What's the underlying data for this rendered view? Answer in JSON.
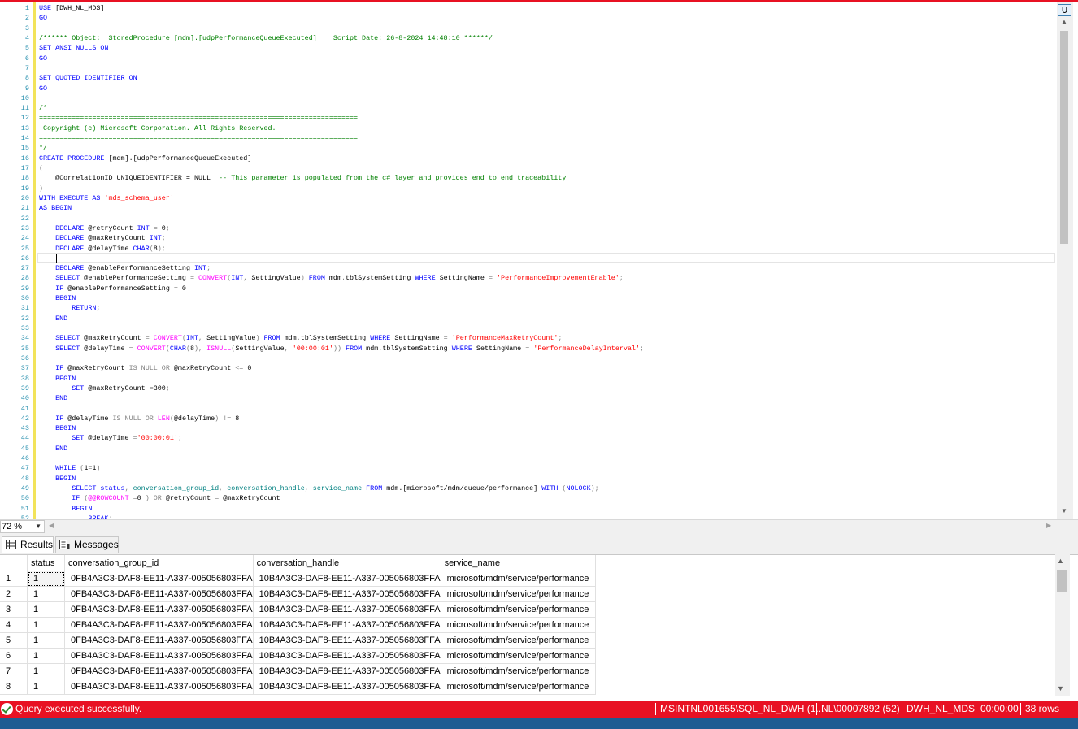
{
  "colors": {
    "status_bar": "#e81123",
    "keyword": "#0000ff",
    "comment": "#008000",
    "string": "#ff0000",
    "function": "#ff00ff",
    "line_number": "#2b91af",
    "bottom_bar": "#1e5c92"
  },
  "editor": {
    "line_numbers": [
      "1",
      "2",
      "3",
      "4",
      "5",
      "6",
      "7",
      "8",
      "9",
      "10",
      "11",
      "12",
      "13",
      "14",
      "15",
      "16",
      "17",
      "18",
      "19",
      "20",
      "21",
      "22",
      "23",
      "24",
      "25",
      "26",
      "27",
      "28",
      "29",
      "30",
      "31",
      "32",
      "33",
      "34",
      "35",
      "36",
      "37",
      "38",
      "39",
      "40",
      "41",
      "42",
      "43",
      "44",
      "45",
      "46",
      "47",
      "48",
      "49",
      "50",
      "51",
      "52"
    ],
    "lines": {
      "l1": "[DWH_NL_MDS]",
      "l4a": "/****** Object:  StoredProcedure [mdm].[udpPerformanceQueueExecuted]    Script Date: 26-8-2024 14:48:10 ******/",
      "l12": "==============================================================================",
      "l13": " Copyright (c) Microsoft Corporation. All Rights Reserved.",
      "l14": "==============================================================================",
      "l16": "[mdm].[udpPerformanceQueueExecuted]",
      "l18_param": "    @CorrelationID UNIQUEIDENTIFIER = NULL",
      "l18_comment": "  -- This parameter is populated from the c# layer and provides end to end traceability",
      "l20_str": "'mds_schema_user'",
      "l28_str": "'PerformanceImprovementEnable'",
      "l34_str": "'PerformanceMaxRetryCount'",
      "l35_str1": "'00:00:01'",
      "l35_str2": "'PerformanceDelayInterval'",
      "l44_str": "'00:00:01'",
      "l49_tbl": "mdm.[microsoft/mdm/queue/performance]"
    }
  },
  "zoom": {
    "value": "72 %"
  },
  "results": {
    "tabs": [
      {
        "label": "Results"
      },
      {
        "label": "Messages"
      }
    ],
    "columns": [
      "status",
      "conversation_group_id",
      "conversation_handle",
      "service_name"
    ],
    "rows": [
      {
        "n": "1",
        "status": "1",
        "group": "0FB4A3C3-DAF8-EE11-A337-005056803FFA",
        "handle": "10B4A3C3-DAF8-EE11-A337-005056803FFA",
        "service": "microsoft/mdm/service/performance"
      },
      {
        "n": "2",
        "status": "1",
        "group": "0FB4A3C3-DAF8-EE11-A337-005056803FFA",
        "handle": "10B4A3C3-DAF8-EE11-A337-005056803FFA",
        "service": "microsoft/mdm/service/performance"
      },
      {
        "n": "3",
        "status": "1",
        "group": "0FB4A3C3-DAF8-EE11-A337-005056803FFA",
        "handle": "10B4A3C3-DAF8-EE11-A337-005056803FFA",
        "service": "microsoft/mdm/service/performance"
      },
      {
        "n": "4",
        "status": "1",
        "group": "0FB4A3C3-DAF8-EE11-A337-005056803FFA",
        "handle": "10B4A3C3-DAF8-EE11-A337-005056803FFA",
        "service": "microsoft/mdm/service/performance"
      },
      {
        "n": "5",
        "status": "1",
        "group": "0FB4A3C3-DAF8-EE11-A337-005056803FFA",
        "handle": "10B4A3C3-DAF8-EE11-A337-005056803FFA",
        "service": "microsoft/mdm/service/performance"
      },
      {
        "n": "6",
        "status": "1",
        "group": "0FB4A3C3-DAF8-EE11-A337-005056803FFA",
        "handle": "10B4A3C3-DAF8-EE11-A337-005056803FFA",
        "service": "microsoft/mdm/service/performance"
      },
      {
        "n": "7",
        "status": "1",
        "group": "0FB4A3C3-DAF8-EE11-A337-005056803FFA",
        "handle": "10B4A3C3-DAF8-EE11-A337-005056803FFA",
        "service": "microsoft/mdm/service/performance"
      },
      {
        "n": "8",
        "status": "1",
        "group": "0FB4A3C3-DAF8-EE11-A337-005056803FFA",
        "handle": "10B4A3C3-DAF8-EE11-A337-005056803FFA",
        "service": "microsoft/mdm/service/performance"
      }
    ]
  },
  "status": {
    "message": "Query executed successfully.",
    "server": "MSINTNL001655\\SQL_NL_DWH (1...",
    "user": "NL\\00007892 (52)",
    "database": "DWH_NL_MDS",
    "elapsed": "00:00:00",
    "row_count": "38 rows"
  }
}
